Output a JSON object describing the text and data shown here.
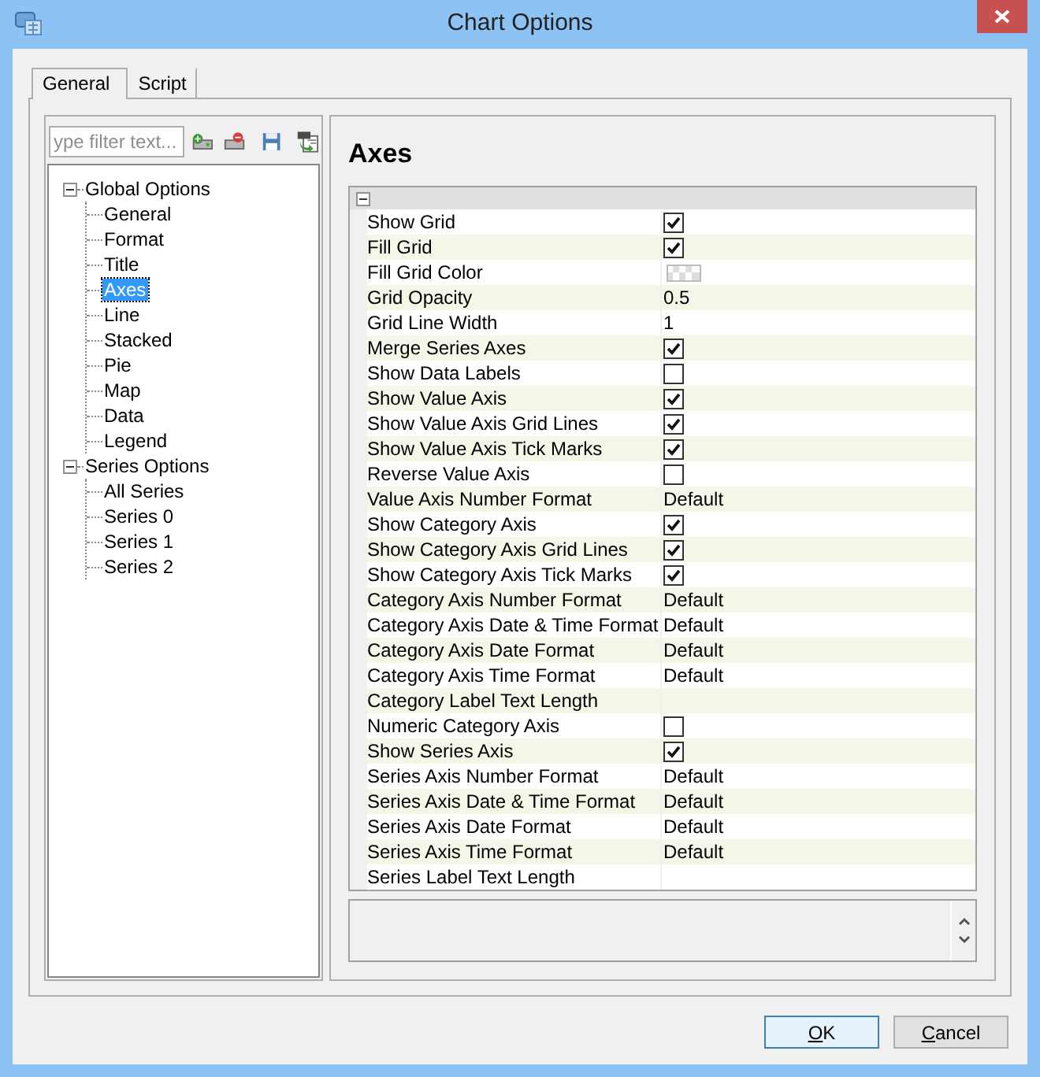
{
  "window": {
    "title": "Chart Options"
  },
  "tabs": [
    {
      "label": "General",
      "selected": true
    },
    {
      "label": "Script",
      "selected": false
    }
  ],
  "filter": {
    "placeholder": "ype filter text..."
  },
  "tree": [
    {
      "label": "Global Options",
      "expanded": true,
      "selected": false,
      "children": [
        {
          "label": "General",
          "selected": false
        },
        {
          "label": "Format",
          "selected": false
        },
        {
          "label": "Title",
          "selected": false
        },
        {
          "label": "Axes",
          "selected": true
        },
        {
          "label": "Line",
          "selected": false
        },
        {
          "label": "Stacked",
          "selected": false
        },
        {
          "label": "Pie",
          "selected": false
        },
        {
          "label": "Map",
          "selected": false
        },
        {
          "label": "Data",
          "selected": false
        },
        {
          "label": "Legend",
          "selected": false
        }
      ]
    },
    {
      "label": "Series Options",
      "expanded": true,
      "selected": false,
      "children": [
        {
          "label": "All Series",
          "selected": false
        },
        {
          "label": "Series 0",
          "selected": false
        },
        {
          "label": "Series 1",
          "selected": false
        },
        {
          "label": "Series 2",
          "selected": false
        }
      ]
    }
  ],
  "heading": "Axes",
  "grid": {
    "expanded": true,
    "rows": [
      {
        "label": "Show Grid",
        "kind": "check",
        "checked": true
      },
      {
        "label": "Fill Grid",
        "kind": "check",
        "checked": true
      },
      {
        "label": "Fill Grid Color",
        "kind": "color"
      },
      {
        "label": "Grid Opacity",
        "kind": "text",
        "value": "0.5"
      },
      {
        "label": "Grid Line Width",
        "kind": "text",
        "value": "1"
      },
      {
        "label": "Merge Series Axes",
        "kind": "check",
        "checked": true
      },
      {
        "label": "Show Data Labels",
        "kind": "check",
        "checked": false
      },
      {
        "label": "Show Value Axis",
        "kind": "check",
        "checked": true
      },
      {
        "label": "Show Value Axis Grid Lines",
        "kind": "check",
        "checked": true
      },
      {
        "label": "Show Value Axis Tick Marks",
        "kind": "check",
        "checked": true
      },
      {
        "label": "Reverse Value Axis",
        "kind": "check",
        "checked": false
      },
      {
        "label": "Value Axis Number Format",
        "kind": "text",
        "value": "Default"
      },
      {
        "label": "Show Category Axis",
        "kind": "check",
        "checked": true
      },
      {
        "label": "Show Category Axis Grid Lines",
        "kind": "check",
        "checked": true
      },
      {
        "label": "Show Category Axis Tick Marks",
        "kind": "check",
        "checked": true
      },
      {
        "label": "Category Axis Number Format",
        "kind": "text",
        "value": "Default"
      },
      {
        "label": "Category Axis Date & Time Format",
        "kind": "text",
        "value": "Default"
      },
      {
        "label": "Category Axis Date Format",
        "kind": "text",
        "value": "Default"
      },
      {
        "label": "Category Axis Time Format",
        "kind": "text",
        "value": "Default"
      },
      {
        "label": "Category Label Text Length",
        "kind": "empty"
      },
      {
        "label": "Numeric Category Axis",
        "kind": "check",
        "checked": false
      },
      {
        "label": "Show Series Axis",
        "kind": "check",
        "checked": true
      },
      {
        "label": "Series Axis Number Format",
        "kind": "text",
        "value": "Default"
      },
      {
        "label": "Series Axis Date & Time Format",
        "kind": "text",
        "value": "Default"
      },
      {
        "label": "Series Axis Date Format",
        "kind": "text",
        "value": "Default"
      },
      {
        "label": "Series Axis Time Format",
        "kind": "text",
        "value": "Default"
      },
      {
        "label": "Series Label Text Length",
        "kind": "empty"
      }
    ]
  },
  "buttons": [
    {
      "label": "OK",
      "kind": "default"
    },
    {
      "label": "Cancel",
      "kind": "normal"
    }
  ]
}
